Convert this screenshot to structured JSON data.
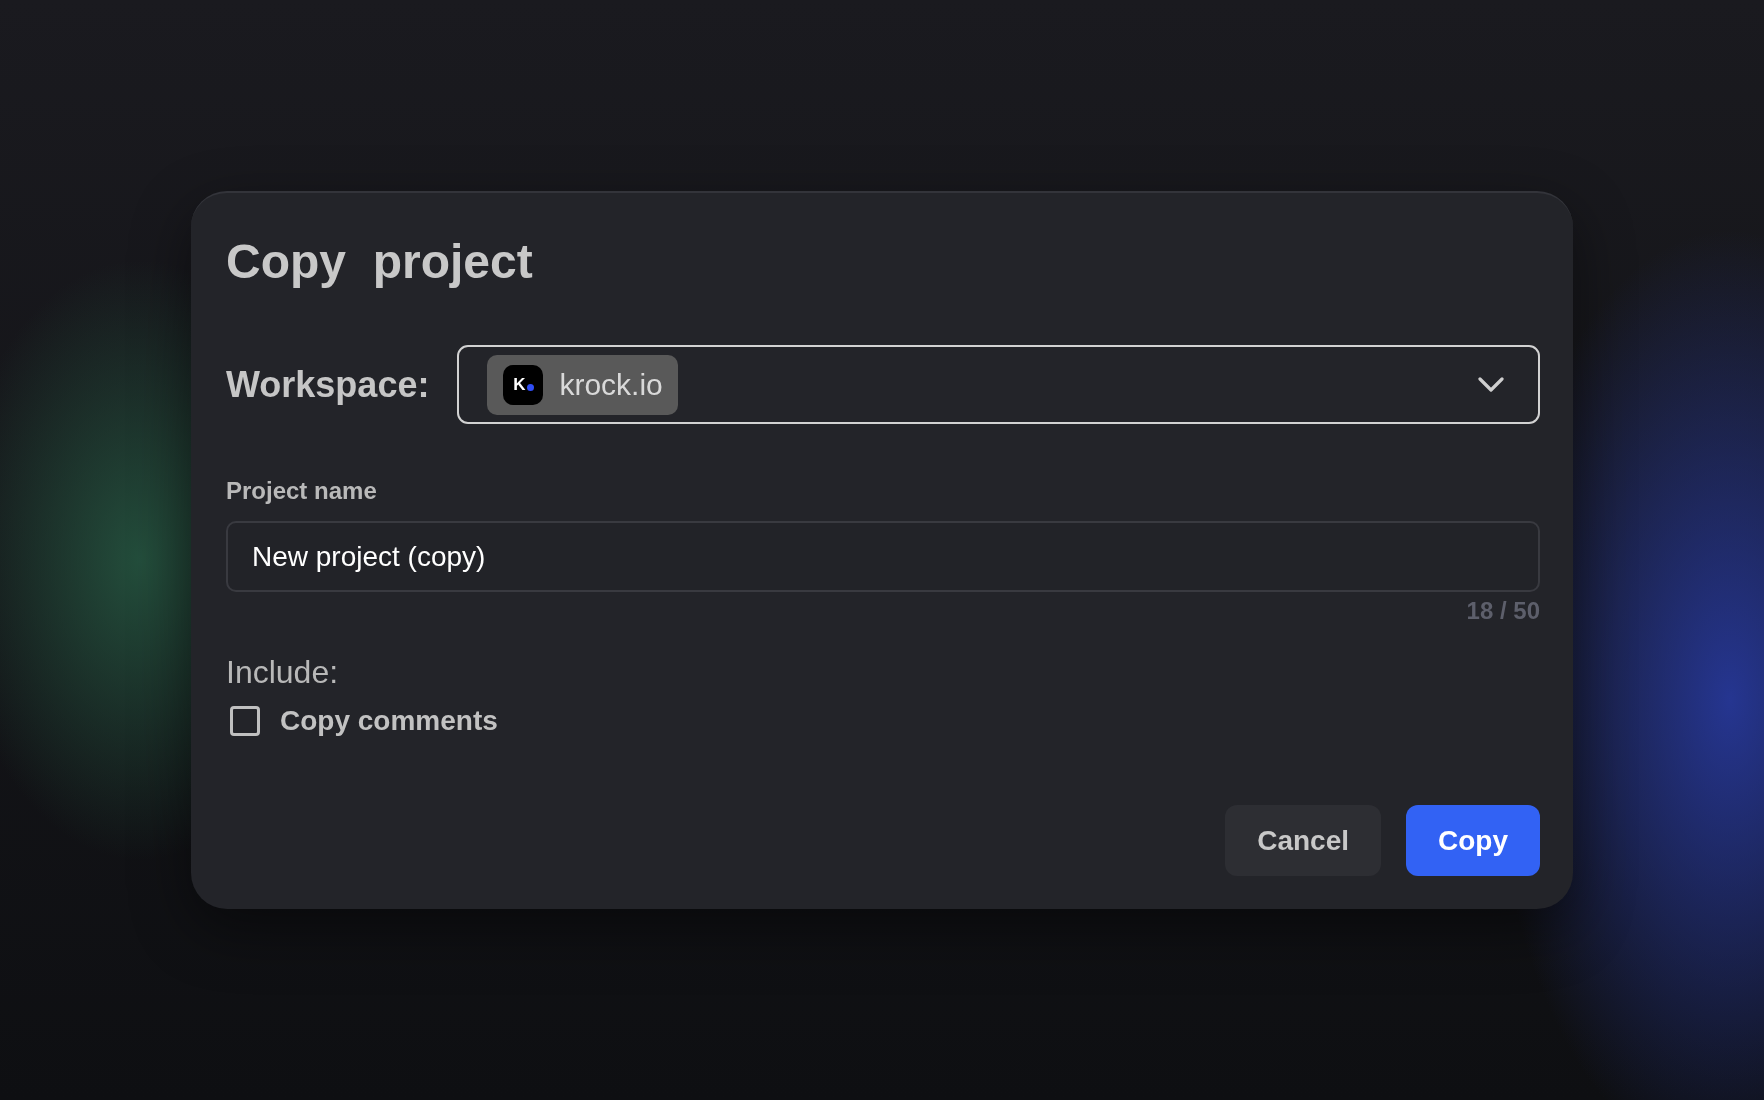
{
  "dialog": {
    "title": "Copy  project"
  },
  "workspace": {
    "label": "Workspace:",
    "selected": {
      "logo_text": "K",
      "name": "krock.io"
    }
  },
  "project_name": {
    "label": "Project name",
    "value": "New project (copy)",
    "counter": "18 / 50"
  },
  "include": {
    "label": "Include:",
    "options": [
      {
        "label": "Copy comments",
        "checked": false
      }
    ]
  },
  "buttons": [
    {
      "label": "Cancel",
      "kind": "secondary"
    },
    {
      "label": "Copy",
      "kind": "primary"
    }
  ]
}
